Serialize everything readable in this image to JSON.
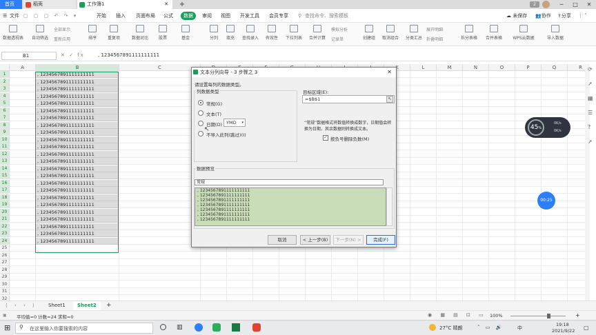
{
  "titlebar": {
    "tabs": [
      {
        "label": "首页"
      },
      {
        "label": "稻壳"
      },
      {
        "label": "工作簿1"
      }
    ],
    "new_tab": "+",
    "page_num": "2",
    "min": "─",
    "max": "□",
    "close": "✕"
  },
  "menubar": {
    "file": "文件",
    "items": [
      "开始",
      "插入",
      "页面布局",
      "公式",
      "数据",
      "审阅",
      "视图",
      "开发工具",
      "会员专享"
    ],
    "search": "查找命令、搜索模板",
    "save_state": "未保存",
    "collab": "协作",
    "share": "分享"
  },
  "toolbar": {
    "tools": [
      "数据透视表",
      "自动筛选",
      "全部显示",
      "重新应用",
      "排序",
      "重复项",
      "数据对比",
      "股票",
      "基金",
      "分列",
      "填充",
      "查找录入",
      "有效性",
      "下拉列表",
      "合并计算",
      "记录单",
      "创建组",
      "取消组合",
      "分类汇总",
      "展开明细",
      "拆分表格",
      "合并表格",
      "WPS云数据",
      "导入数据"
    ],
    "small": [
      "全部显示",
      "重新应用",
      "模拟分析",
      "记录单",
      "展开明细",
      "折叠明细"
    ]
  },
  "formulabar": {
    "namebox": "B1",
    "fx_icons": "✕ ✓ fx",
    "value": ", 1234567891111111111"
  },
  "grid": {
    "columns": [
      "A",
      "B",
      "C",
      "D",
      "E",
      "F",
      "G",
      "H",
      "I",
      "J",
      "K",
      "L",
      "M",
      "N",
      "O",
      "P",
      "Q",
      "R"
    ],
    "rows": [
      "1",
      "2",
      "3",
      "4",
      "5",
      "6",
      "7",
      "8",
      "9",
      "10",
      "11",
      "12",
      "13",
      "14",
      "15",
      "16",
      "17",
      "18",
      "19",
      "20",
      "21",
      "22",
      "23",
      "24",
      "25",
      "26",
      "27",
      "28",
      "29",
      "30",
      "31",
      "32"
    ],
    "b_values": [
      ", 1234567891111111111",
      ", 1234567891111111111",
      ", 1234567891111111111",
      ", 1234567891111111111",
      ", 1234567891111111111",
      ", 1234567891111111111",
      ", 1234567891111111111",
      ", 1234567891111111111",
      ", 1234567891111111111",
      ", 1234567891111111111",
      ", 1234567891111111111",
      ", 1234567891111111111",
      ", 1234567891111111111",
      ", 1234567891111111111",
      ", 1234567891111111111",
      ", 1234567891111111111",
      ", 1234567891111111111",
      ", 1234567891111111111",
      ", 1234567891111111111",
      ", 1234567891111111111",
      ", 1234567891111111111",
      ", 1234567891111111111",
      ", 1234567891111111111",
      ", 1234567891111111111"
    ]
  },
  "dialog": {
    "title": "文本分列向导 - 3 步骤之 3",
    "instruction": "请设置每列的数据类型。",
    "group_label": "列数据类型",
    "options": [
      {
        "label": "常规(G)"
      },
      {
        "label": "文本(T)"
      },
      {
        "label": "日期(D)"
      },
      {
        "label": "不导入此列(跳过)(I)"
      }
    ],
    "date_format": "YMD",
    "target_label": "目标区域(E):",
    "target_value": "=$B$1",
    "desc": "“常规”数据格式将数值转换成数字，日期值会转换为日期，其余数据则转换成文本。",
    "checkbox_label": "按负号删除负数(M)",
    "preview_label": "数据预览",
    "preview_header": "常规",
    "preview_rows": [
      ", 1234567891111111111",
      ", 1234567891111111111",
      ", 1234567891111111111",
      ", 1234567891111111111",
      ", 1234567891111111111",
      ", 1234567891111111111",
      ", 1234567891111111111"
    ],
    "btn_cancel": "取消",
    "btn_prev": "< 上一步(B)",
    "btn_next": "下一步(N) >",
    "btn_finish": "完成(F)"
  },
  "sheets": {
    "tabs": [
      "Sheet1",
      "Sheet2"
    ],
    "add": "+"
  },
  "statusbar": {
    "text": "平均值=0  计数=24  求和=0",
    "zoom": "100%"
  },
  "taskbar": {
    "search": "在这里输入你要搜索的内容",
    "weather": "27°C 晴朗",
    "time": "19:18",
    "date": "2021/9/22",
    "lang": "中"
  },
  "floating": {
    "speed": "45",
    "speed_unit": "%",
    "net_up": "0K/s",
    "net_down": "0K/s",
    "timer": "00:25"
  },
  "colors": {
    "accent": "#1a9e5c",
    "brand_blue": "#2d7ff9",
    "preview_bg": "#c9ddb9"
  }
}
